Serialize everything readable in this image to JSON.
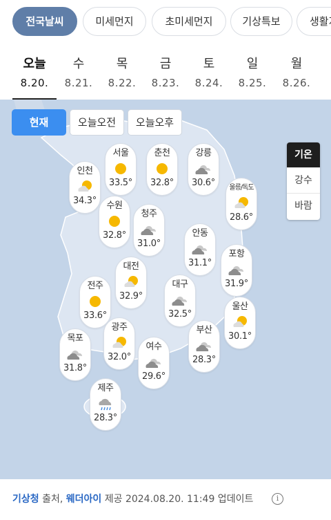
{
  "top_tabs": [
    {
      "label": "전국날씨",
      "active": true
    },
    {
      "label": "미세먼지"
    },
    {
      "label": "초미세먼지"
    },
    {
      "label": "기상특보"
    },
    {
      "label": "생활지"
    }
  ],
  "days": [
    {
      "name": "오늘",
      "date": "8.20.",
      "active": true
    },
    {
      "name": "수",
      "date": "8.21."
    },
    {
      "name": "목",
      "date": "8.22."
    },
    {
      "name": "금",
      "date": "8.23."
    },
    {
      "name": "토",
      "date": "8.24."
    },
    {
      "name": "일",
      "date": "8.25."
    },
    {
      "name": "월",
      "date": "8.26."
    }
  ],
  "time_buttons": [
    "현재",
    "오늘오전",
    "오늘오후"
  ],
  "side_toggle": [
    "기온",
    "강수",
    "바람"
  ],
  "cities": [
    {
      "name": "서울",
      "icon": "sun-icon",
      "temp": "33.5°"
    },
    {
      "name": "춘천",
      "icon": "sun-icon",
      "temp": "32.8°"
    },
    {
      "name": "강릉",
      "icon": "cloudy-icon",
      "temp": "30.6°"
    },
    {
      "name": "인천",
      "icon": "partly-cloudy-icon",
      "temp": "34.3°"
    },
    {
      "name": "울릉/독도",
      "icon": "partly-cloudy-icon",
      "temp": "28.6°"
    },
    {
      "name": "수원",
      "icon": "sun-icon",
      "temp": "32.8°"
    },
    {
      "name": "청주",
      "icon": "cloudy-icon",
      "temp": "31.0°"
    },
    {
      "name": "안동",
      "icon": "cloudy-icon",
      "temp": "31.1°"
    },
    {
      "name": "포항",
      "icon": "cloudy-icon",
      "temp": "31.9°"
    },
    {
      "name": "대전",
      "icon": "partly-cloudy-icon",
      "temp": "32.9°"
    },
    {
      "name": "전주",
      "icon": "sun-icon",
      "temp": "33.6°"
    },
    {
      "name": "대구",
      "icon": "cloudy-icon",
      "temp": "32.5°"
    },
    {
      "name": "울산",
      "icon": "partly-cloudy-icon",
      "temp": "30.1°"
    },
    {
      "name": "광주",
      "icon": "partly-cloudy-icon",
      "temp": "32.0°"
    },
    {
      "name": "부산",
      "icon": "cloudy-icon",
      "temp": "28.3°"
    },
    {
      "name": "목포",
      "icon": "cloudy-icon",
      "temp": "31.8°"
    },
    {
      "name": "여수",
      "icon": "cloudy-icon",
      "temp": "29.6°"
    },
    {
      "name": "제주",
      "icon": "rain-icon",
      "temp": "28.3°"
    }
  ],
  "footer": {
    "source": "기상청",
    "source_suffix": " 출처, ",
    "provider": "웨더아이",
    "provider_suffix": " 제공 2024.08.20. 11:49 업데이트"
  },
  "colors": {
    "active_tab": "#5f7ea8",
    "active_button": "#3b8ef0",
    "sea": "#c3d4e8",
    "land": "#dde6f2",
    "link": "#2a68c4"
  }
}
